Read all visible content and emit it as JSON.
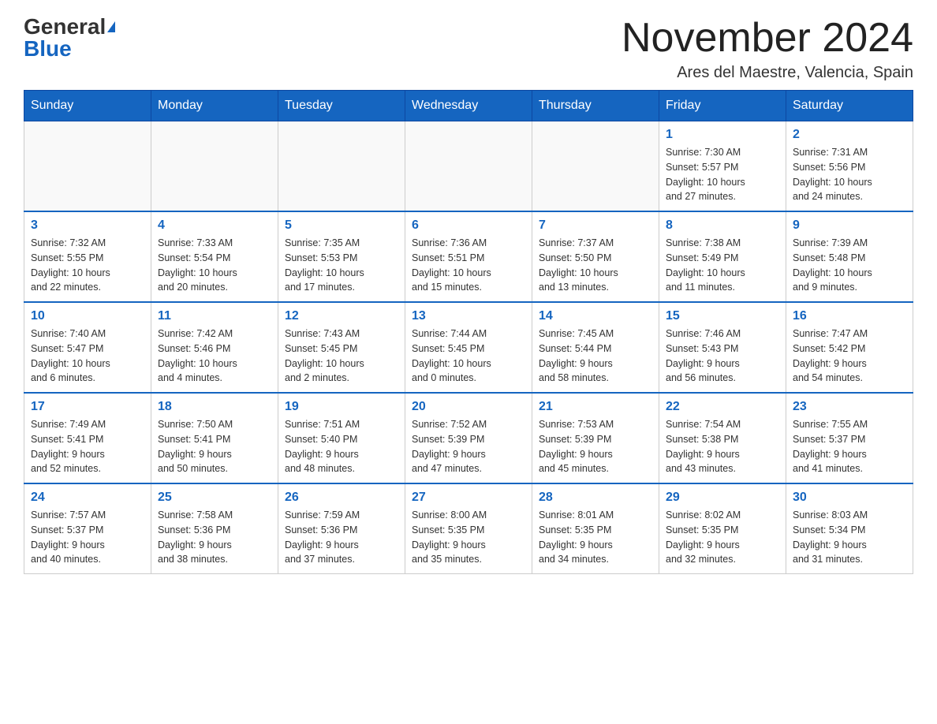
{
  "header": {
    "logo_general": "General",
    "logo_blue": "Blue",
    "month_title": "November 2024",
    "location": "Ares del Maestre, Valencia, Spain"
  },
  "weekdays": [
    "Sunday",
    "Monday",
    "Tuesday",
    "Wednesday",
    "Thursday",
    "Friday",
    "Saturday"
  ],
  "weeks": [
    [
      {
        "day": "",
        "info": ""
      },
      {
        "day": "",
        "info": ""
      },
      {
        "day": "",
        "info": ""
      },
      {
        "day": "",
        "info": ""
      },
      {
        "day": "",
        "info": ""
      },
      {
        "day": "1",
        "info": "Sunrise: 7:30 AM\nSunset: 5:57 PM\nDaylight: 10 hours\nand 27 minutes."
      },
      {
        "day": "2",
        "info": "Sunrise: 7:31 AM\nSunset: 5:56 PM\nDaylight: 10 hours\nand 24 minutes."
      }
    ],
    [
      {
        "day": "3",
        "info": "Sunrise: 7:32 AM\nSunset: 5:55 PM\nDaylight: 10 hours\nand 22 minutes."
      },
      {
        "day": "4",
        "info": "Sunrise: 7:33 AM\nSunset: 5:54 PM\nDaylight: 10 hours\nand 20 minutes."
      },
      {
        "day": "5",
        "info": "Sunrise: 7:35 AM\nSunset: 5:53 PM\nDaylight: 10 hours\nand 17 minutes."
      },
      {
        "day": "6",
        "info": "Sunrise: 7:36 AM\nSunset: 5:51 PM\nDaylight: 10 hours\nand 15 minutes."
      },
      {
        "day": "7",
        "info": "Sunrise: 7:37 AM\nSunset: 5:50 PM\nDaylight: 10 hours\nand 13 minutes."
      },
      {
        "day": "8",
        "info": "Sunrise: 7:38 AM\nSunset: 5:49 PM\nDaylight: 10 hours\nand 11 minutes."
      },
      {
        "day": "9",
        "info": "Sunrise: 7:39 AM\nSunset: 5:48 PM\nDaylight: 10 hours\nand 9 minutes."
      }
    ],
    [
      {
        "day": "10",
        "info": "Sunrise: 7:40 AM\nSunset: 5:47 PM\nDaylight: 10 hours\nand 6 minutes."
      },
      {
        "day": "11",
        "info": "Sunrise: 7:42 AM\nSunset: 5:46 PM\nDaylight: 10 hours\nand 4 minutes."
      },
      {
        "day": "12",
        "info": "Sunrise: 7:43 AM\nSunset: 5:45 PM\nDaylight: 10 hours\nand 2 minutes."
      },
      {
        "day": "13",
        "info": "Sunrise: 7:44 AM\nSunset: 5:45 PM\nDaylight: 10 hours\nand 0 minutes."
      },
      {
        "day": "14",
        "info": "Sunrise: 7:45 AM\nSunset: 5:44 PM\nDaylight: 9 hours\nand 58 minutes."
      },
      {
        "day": "15",
        "info": "Sunrise: 7:46 AM\nSunset: 5:43 PM\nDaylight: 9 hours\nand 56 minutes."
      },
      {
        "day": "16",
        "info": "Sunrise: 7:47 AM\nSunset: 5:42 PM\nDaylight: 9 hours\nand 54 minutes."
      }
    ],
    [
      {
        "day": "17",
        "info": "Sunrise: 7:49 AM\nSunset: 5:41 PM\nDaylight: 9 hours\nand 52 minutes."
      },
      {
        "day": "18",
        "info": "Sunrise: 7:50 AM\nSunset: 5:41 PM\nDaylight: 9 hours\nand 50 minutes."
      },
      {
        "day": "19",
        "info": "Sunrise: 7:51 AM\nSunset: 5:40 PM\nDaylight: 9 hours\nand 48 minutes."
      },
      {
        "day": "20",
        "info": "Sunrise: 7:52 AM\nSunset: 5:39 PM\nDaylight: 9 hours\nand 47 minutes."
      },
      {
        "day": "21",
        "info": "Sunrise: 7:53 AM\nSunset: 5:39 PM\nDaylight: 9 hours\nand 45 minutes."
      },
      {
        "day": "22",
        "info": "Sunrise: 7:54 AM\nSunset: 5:38 PM\nDaylight: 9 hours\nand 43 minutes."
      },
      {
        "day": "23",
        "info": "Sunrise: 7:55 AM\nSunset: 5:37 PM\nDaylight: 9 hours\nand 41 minutes."
      }
    ],
    [
      {
        "day": "24",
        "info": "Sunrise: 7:57 AM\nSunset: 5:37 PM\nDaylight: 9 hours\nand 40 minutes."
      },
      {
        "day": "25",
        "info": "Sunrise: 7:58 AM\nSunset: 5:36 PM\nDaylight: 9 hours\nand 38 minutes."
      },
      {
        "day": "26",
        "info": "Sunrise: 7:59 AM\nSunset: 5:36 PM\nDaylight: 9 hours\nand 37 minutes."
      },
      {
        "day": "27",
        "info": "Sunrise: 8:00 AM\nSunset: 5:35 PM\nDaylight: 9 hours\nand 35 minutes."
      },
      {
        "day": "28",
        "info": "Sunrise: 8:01 AM\nSunset: 5:35 PM\nDaylight: 9 hours\nand 34 minutes."
      },
      {
        "day": "29",
        "info": "Sunrise: 8:02 AM\nSunset: 5:35 PM\nDaylight: 9 hours\nand 32 minutes."
      },
      {
        "day": "30",
        "info": "Sunrise: 8:03 AM\nSunset: 5:34 PM\nDaylight: 9 hours\nand 31 minutes."
      }
    ]
  ]
}
